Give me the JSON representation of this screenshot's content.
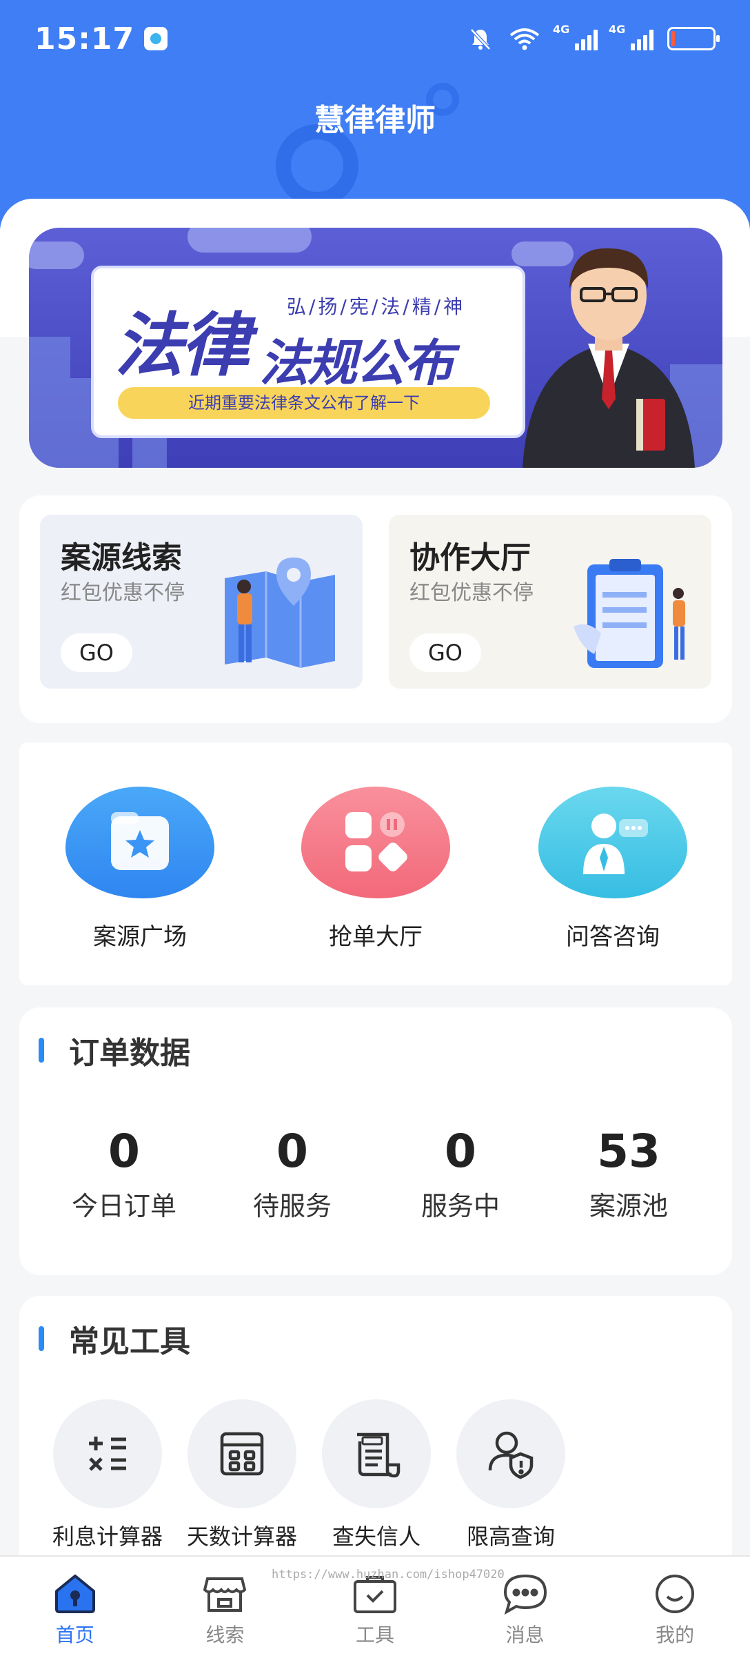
{
  "status_bar": {
    "time": "15:17",
    "signal1": "4G",
    "signal2": "4G"
  },
  "header": {
    "title": "慧律律师"
  },
  "banner": {
    "headline_part1": "法律",
    "headline_part2": "法规公布",
    "tagline": "弘/扬/宪/法/精/神",
    "pill": "近期重要法律条文公布了解一下"
  },
  "promos": [
    {
      "title": "案源线索",
      "subtitle": "红包优惠不停",
      "button": "GO"
    },
    {
      "title": "协作大厅",
      "subtitle": "红包优惠不停",
      "button": "GO"
    }
  ],
  "quick_entries": [
    {
      "label": "案源广场",
      "icon": "folder-star-icon",
      "color": "#3a95f5"
    },
    {
      "label": "抢单大厅",
      "icon": "grid-apps-icon",
      "color": "#f2707f"
    },
    {
      "label": "问答咨询",
      "icon": "person-chat-icon",
      "color": "#3cc6e6"
    }
  ],
  "orders": {
    "title": "订单数据",
    "stats": [
      {
        "value": "0",
        "label": "今日订单"
      },
      {
        "value": "0",
        "label": "待服务"
      },
      {
        "value": "0",
        "label": "服务中"
      },
      {
        "value": "53",
        "label": "案源池"
      }
    ]
  },
  "tools": {
    "title": "常见工具",
    "items": [
      {
        "label": "利息计算器",
        "icon": "calculator-icon"
      },
      {
        "label": "天数计算器",
        "icon": "calendar-icon"
      },
      {
        "label": "查失信人",
        "icon": "scroll-icon"
      },
      {
        "label": "限高查询",
        "icon": "person-shield-icon"
      }
    ]
  },
  "tabbar": [
    {
      "label": "首页",
      "icon": "home-icon",
      "active": true
    },
    {
      "label": "线索",
      "icon": "store-icon",
      "active": false
    },
    {
      "label": "工具",
      "icon": "toolbox-icon",
      "active": false
    },
    {
      "label": "消息",
      "icon": "message-icon",
      "active": false
    },
    {
      "label": "我的",
      "icon": "smile-icon",
      "active": false
    }
  ],
  "watermark": "https://www.huzhan.com/ishop47020",
  "colors": {
    "primary": "#3f7ef4",
    "accent": "#2a73f0"
  }
}
